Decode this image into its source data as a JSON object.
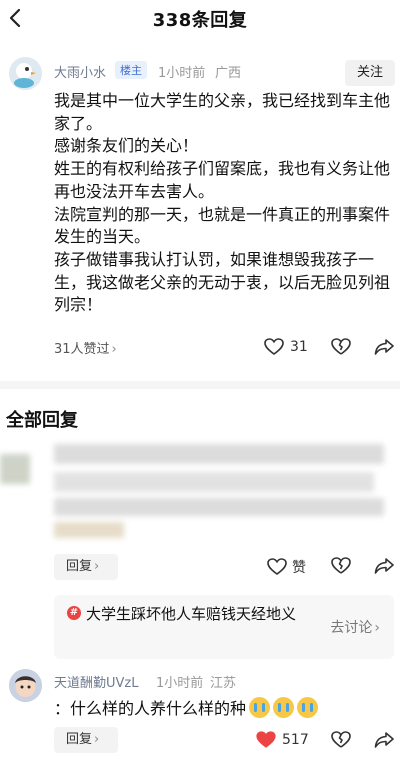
{
  "header": {
    "title": "338条回复"
  },
  "post": {
    "author": "大雨小水",
    "badge": "楼主",
    "time": "1小时前",
    "location": "广西",
    "follow_label": "关注",
    "paragraphs": [
      "我是其中一位大学生的父亲，我已经找到车主他家了。",
      "感谢条友们的关心！",
      "姓王的有权利给孩子们留案底，我也有义务让他再也没法开车去害人。",
      "法院宣判的那一天，也就是一件真正的刑事案件发生的当天。",
      "孩子做错事我认打认罚，如果谁想毁我孩子一生，我这做老父亲的无动于衷，以后无脸见列祖列宗！"
    ],
    "likers_label": "31人赞过",
    "like_count": "31"
  },
  "section": {
    "title": "全部回复"
  },
  "reply1": {
    "reply_label": "回复",
    "like_label": "赞"
  },
  "topic": {
    "hash": "#",
    "text": "大学生踩坏他人车赔钱天经地义",
    "link": "去讨论"
  },
  "reply2": {
    "author": "天道酬勤UVzL",
    "time": "1小时前",
    "location": "江苏",
    "text": "：什么样的人养什么样的种",
    "reply_label": "回复",
    "like_count": "517"
  },
  "colors": {
    "accent_red": "#ec4343",
    "badge_blue": "#3f6fd1",
    "name_gray": "#6f7b8e"
  }
}
